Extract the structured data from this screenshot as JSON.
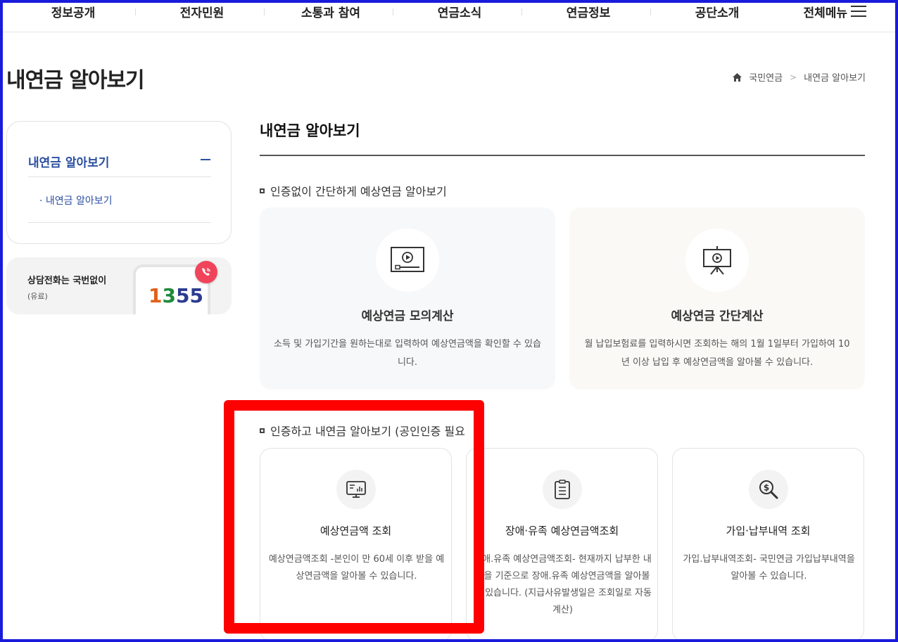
{
  "nav": {
    "items": [
      "정보공개",
      "전자민원",
      "소통과 참여",
      "연금소식",
      "연금정보",
      "공단소개"
    ],
    "all_menu": "전체메뉴"
  },
  "page": {
    "title": "내연금 알아보기",
    "breadcrumb": [
      "국민연금",
      "내연금 알아보기"
    ]
  },
  "sidebar": {
    "header": "내연금 알아보기",
    "sub_item": "· 내연금 알아보기",
    "call_label": "상담전화는 국번없이",
    "call_paid": "(유료)",
    "call_number_digits": [
      "1",
      "3",
      "5",
      "5"
    ],
    "call_number_colors": [
      "#e0601a",
      "#1f8a3a",
      "#2b3b8f",
      "#2b3b8f"
    ],
    "badge_color": "#f0445a"
  },
  "content": {
    "title": "내연금 알아보기",
    "section1": {
      "title": "인증없이 간단하게 예상연금 알아보기",
      "cards": [
        {
          "title": "예상연금 모의계산",
          "desc": "소득 및 가입기간을 원하는대로 입력하여 예상연금액을 확인할 수 있습니다.",
          "icon": "video-play-icon"
        },
        {
          "title": "예상연금 간단계산",
          "desc": "월 납입보험료를 입력하시면 조회하는 해의 1월 1일부터 가입하여 10년 이상 납입 후 예상연금액을 알아볼 수 있습니다.",
          "icon": "presentation-play-icon"
        }
      ]
    },
    "section2": {
      "title": "인증하고 내연금 알아보기 (공인인증 필요",
      "cards": [
        {
          "title": "예상연금액 조회",
          "desc": "예상연금액조회 -본인이 만 60세 이후 받을 예상연금액을 알아볼 수 있습니다.",
          "icon": "monitor-chart-icon"
        },
        {
          "title": "장애·유족 예상연금액조회",
          "desc": "장애.유족 예상연금액조회- 현재까지 납부한 내역을 기준으로 장애.유족 예상연금액을 알아볼 수 있습니다. (지급사유발생일은 조회일로 자동계산)",
          "icon": "clipboard-icon"
        },
        {
          "title": "가입·납부내역 조회",
          "desc": "가입.납부내역조회- 국민연금 가입납부내역을 알아볼 수 있습니다.",
          "icon": "search-dollar-icon"
        }
      ]
    }
  },
  "colors": {
    "accent": "#2b4fa0",
    "highlight": "#ff0000",
    "frame": "#1a1adb"
  }
}
